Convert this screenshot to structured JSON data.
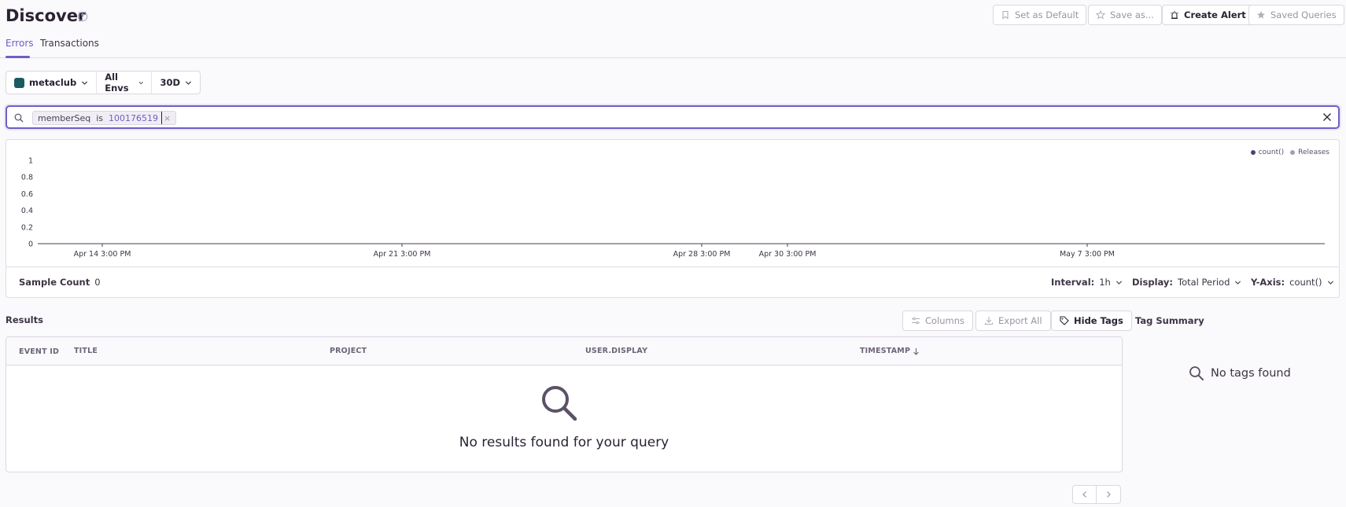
{
  "header": {
    "title": "Discover",
    "buttons": {
      "set_default": "Set as Default",
      "save_as": "Save as...",
      "create_alert": "Create Alert",
      "saved_queries": "Saved Queries"
    },
    "tabs": [
      "Errors",
      "Transactions"
    ],
    "active_tab": "Errors"
  },
  "filters": {
    "project": "metaclub",
    "environment": "All Envs",
    "period": "30D"
  },
  "search": {
    "token_key": "memberSeq",
    "token_op": "is",
    "token_value": "100176519",
    "token_remove": "×",
    "value": ""
  },
  "chart_data": {
    "type": "line",
    "title": "",
    "xlabel": "",
    "ylabel": "",
    "y_ticks": [
      "1",
      "0.8",
      "0.6",
      "0.4",
      "0.2",
      "0"
    ],
    "x_ticks": [
      "Apr 14 3:00 PM",
      "Apr 21 3:00 PM",
      "Apr 28 3:00 PM",
      "Apr 30 3:00 PM",
      "May 7 3:00 PM"
    ],
    "ylim": [
      0,
      1
    ],
    "series": [
      {
        "name": "count()",
        "values": []
      },
      {
        "name": "Releases",
        "values": []
      }
    ],
    "legend_position": "top-right",
    "grid": false
  },
  "chart_footer": {
    "sample_count_label": "Sample Count",
    "sample_count_value": "0",
    "interval_label": "Interval:",
    "interval_value": "1h",
    "display_label": "Display:",
    "display_value": "Total Period",
    "yaxis_label": "Y-Axis:",
    "yaxis_value": "count()"
  },
  "results": {
    "label": "Results",
    "columns_button": "Columns",
    "export_button": "Export All",
    "hide_tags_button": "Hide Tags",
    "headers": [
      "EVENT ID",
      "TITLE",
      "PROJECT",
      "USER.DISPLAY",
      "TIMESTAMP"
    ],
    "empty_message": "No results found for your query"
  },
  "tag_summary": {
    "title": "Tag Summary",
    "empty": "No tags found"
  },
  "colors": {
    "accent": "#6c5fc7",
    "series_count": "#444674",
    "series_releases": "#a3a0ab"
  }
}
